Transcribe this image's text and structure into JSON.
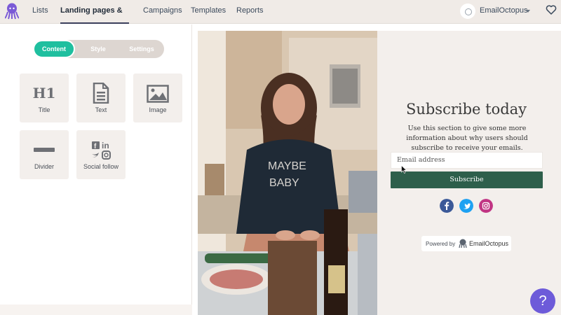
{
  "nav": {
    "items": [
      "Lists",
      "Landing pages & forms",
      "Campaigns",
      "Templates",
      "Reports"
    ],
    "active": "Landing pages & forms",
    "account_name": "EmailOctopus"
  },
  "editor": {
    "tabs": [
      "Content",
      "Style",
      "Settings"
    ],
    "active_tab": "Content",
    "blocks": [
      {
        "label": "Title",
        "icon": "h1-icon",
        "glyph": "H1"
      },
      {
        "label": "Text",
        "icon": "document-icon"
      },
      {
        "label": "Image",
        "icon": "image-icon"
      },
      {
        "label": "Divider",
        "icon": "divider-icon"
      },
      {
        "label": "Social follow",
        "icon": "social-icons"
      }
    ]
  },
  "preview": {
    "heading": "Subscribe today",
    "subtext": "Use this section to give some more information about why users should subscribe to receive your emails.",
    "email_placeholder": "Email address",
    "button_label": "Subscribe",
    "social": [
      "facebook-icon",
      "twitter-icon",
      "instagram-icon"
    ],
    "powered_by": "Powered by",
    "powered_brand": "EmailOctopus"
  },
  "help": {
    "label": "?"
  },
  "colors": {
    "accent": "#1fbf9f",
    "subscribe_button": "#2e5f4b",
    "help_button": "#6d5bd9",
    "facebook": "#3b5998",
    "twitter": "#1da1f2",
    "instagram": "#c13584"
  }
}
